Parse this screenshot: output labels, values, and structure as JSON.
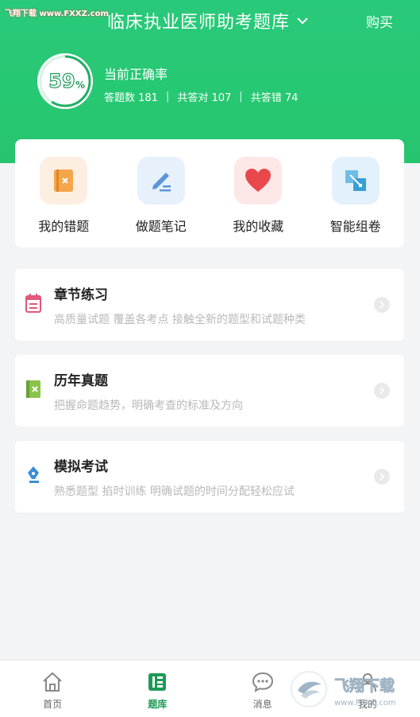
{
  "watermark": "飞翔下载 www.FXXZ.com",
  "header": {
    "title": "临床执业医师助考题库",
    "buy_label": "购买"
  },
  "stats": {
    "percent": "59",
    "percent_sign": "%",
    "title": "当前正确率",
    "answered": "答题数 181",
    "correct": "共答对 107",
    "wrong": "共答错 74",
    "separator": "|"
  },
  "quick_actions": [
    {
      "label": "我的错题",
      "icon": "wrong-questions-icon"
    },
    {
      "label": "做题笔记",
      "icon": "notes-icon"
    },
    {
      "label": "我的收藏",
      "icon": "favorites-heart-icon"
    },
    {
      "label": "智能组卷",
      "icon": "smart-paper-icon"
    }
  ],
  "cards": [
    {
      "title": "章节练习",
      "subtitle": "高质量试题 覆盖各考点 接触全新的题型和试题种类",
      "icon": "calendar-list-icon"
    },
    {
      "title": "历年真题",
      "subtitle": "把握命题趋势，明确考查的标准及方向",
      "icon": "exam-book-icon"
    },
    {
      "title": "模拟考试",
      "subtitle": "熟悉题型 掐时训练 明确试题的时间分配轻松应试",
      "icon": "pen-nib-icon"
    }
  ],
  "tabs": [
    {
      "label": "首页",
      "icon": "home-icon"
    },
    {
      "label": "题库",
      "icon": "question-bank-icon"
    },
    {
      "label": "消息",
      "icon": "message-icon"
    },
    {
      "label": "我的",
      "icon": "profile-icon"
    }
  ],
  "logo": {
    "text": "飞翔下载",
    "url": "www.FXXZ.com"
  },
  "colors": {
    "primary": "#27c873",
    "active_tab": "#1f9a55"
  }
}
